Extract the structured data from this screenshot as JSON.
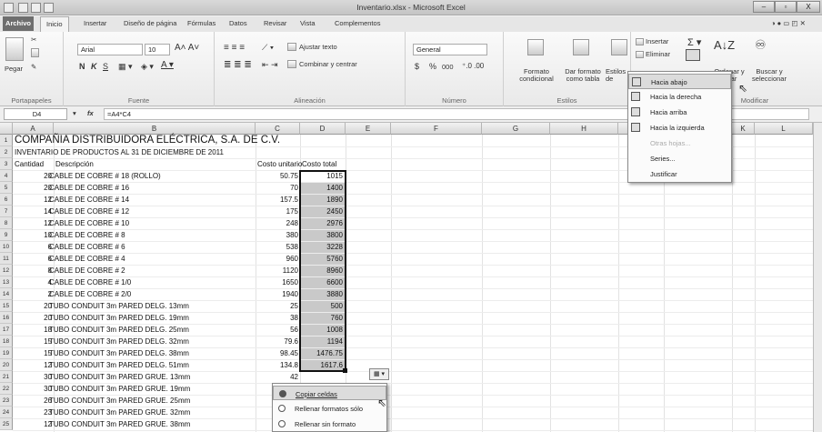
{
  "window": {
    "title": "Inventario.xlsx - Microsoft Excel",
    "minimize": "–",
    "maximize": "▫",
    "close": "X"
  },
  "tabs": [
    "Archivo",
    "Inicio",
    "Insertar",
    "Diseño de página",
    "Fórmulas",
    "Datos",
    "Revisar",
    "Vista",
    "Complementos"
  ],
  "ribbon": {
    "clipboard": {
      "paste": "Pegar",
      "label": "Portapapeles"
    },
    "font": {
      "name": "Arial",
      "size": "10",
      "label": "Fuente",
      "bold": "N",
      "italic": "K",
      "underline": "S"
    },
    "alignment": {
      "wrap": "Ajustar texto",
      "merge": "Combinar y centrar",
      "label": "Alineación"
    },
    "number": {
      "format": "General",
      "currency": "$",
      "percent": "%",
      "thousands": "000",
      "label": "Número"
    },
    "styles": {
      "cond_format": "Formato condicional",
      "as_table": "Dar formato como tabla",
      "cell_styles": "Estilos de celda",
      "label": "Estilos"
    },
    "cells": {
      "insert": "Insertar",
      "delete": "Eliminar"
    },
    "editing": {
      "sort": "Ordenar y filtrar",
      "find": "Buscar y seleccionar",
      "label": "Modificar"
    }
  },
  "formula_bar": {
    "name_box": "D4",
    "fx": "fx",
    "formula": "=A4*C4"
  },
  "columns": [
    "A",
    "B",
    "C",
    "D",
    "E",
    "F",
    "G",
    "H",
    "I",
    "J",
    "K",
    "L"
  ],
  "rows": [
    {
      "n": "1",
      "a": "COMPAÑIA DISTRIBUIDORA ELÉCTRICA, S.A. DE C.V.",
      "title": true
    },
    {
      "n": "2",
      "a": "INVENTARIO DE PRODUCTOS AL 31 DE DICIEMBRE DE 2011"
    },
    {
      "n": "3",
      "a": "Cantidad",
      "b": "Descripción",
      "c": "Costo unitario",
      "d": "Costo total"
    },
    {
      "n": "4",
      "a": "20",
      "b": "CABLE DE COBRE # 18 (ROLLO)",
      "c": "50.75",
      "d": "1015"
    },
    {
      "n": "5",
      "a": "20",
      "b": "CABLE DE COBRE # 16",
      "c": "70",
      "d": "1400"
    },
    {
      "n": "6",
      "a": "12",
      "b": "CABLE DE COBRE # 14",
      "c": "157.5",
      "d": "1890"
    },
    {
      "n": "7",
      "a": "14",
      "b": "CABLE DE COBRE # 12",
      "c": "175",
      "d": "2450"
    },
    {
      "n": "8",
      "a": "12",
      "b": "CABLE DE COBRE # 10",
      "c": "248",
      "d": "2976"
    },
    {
      "n": "9",
      "a": "10",
      "b": "CABLE DE COBRE # 8",
      "c": "380",
      "d": "3800"
    },
    {
      "n": "10",
      "a": "6",
      "b": "CABLE DE COBRE # 6",
      "c": "538",
      "d": "3228"
    },
    {
      "n": "11",
      "a": "6",
      "b": "CABLE DE COBRE # 4",
      "c": "960",
      "d": "5760"
    },
    {
      "n": "12",
      "a": "8",
      "b": "CABLE DE COBRE # 2",
      "c": "1120",
      "d": "8960"
    },
    {
      "n": "13",
      "a": "4",
      "b": "CABLE DE COBRE # 1/0",
      "c": "1650",
      "d": "6600"
    },
    {
      "n": "14",
      "a": "2",
      "b": "CABLE DE COBRE # 2/0",
      "c": "1940",
      "d": "3880"
    },
    {
      "n": "15",
      "a": "20",
      "b": "TUBO CONDUIT 3m PARED DELG. 13mm",
      "c": "25",
      "d": "500"
    },
    {
      "n": "16",
      "a": "20",
      "b": "TUBO CONDUIT 3m PARED DELG. 19mm",
      "c": "38",
      "d": "760"
    },
    {
      "n": "17",
      "a": "18",
      "b": "TUBO CONDUIT 3m PARED DELG. 25mm",
      "c": "56",
      "d": "1008"
    },
    {
      "n": "18",
      "a": "15",
      "b": "TUBO CONDUIT 3m PARED DELG. 32mm",
      "c": "79.6",
      "d": "1194"
    },
    {
      "n": "19",
      "a": "15",
      "b": "TUBO CONDUIT 3m PARED DELG. 38mm",
      "c": "98.45",
      "d": "1476.75"
    },
    {
      "n": "20",
      "a": "12",
      "b": "TUBO CONDUIT 3m PARED DELG. 51mm",
      "c": "134.8",
      "d": "1617.6"
    },
    {
      "n": "21",
      "a": "30",
      "b": "TUBO CONDUIT 3m PARED GRUE. 13mm",
      "c": "42",
      "d": ""
    },
    {
      "n": "22",
      "a": "30",
      "b": "TUBO CONDUIT 3m PARED GRUE. 19mm",
      "c": "",
      "d": ""
    },
    {
      "n": "23",
      "a": "26",
      "b": "TUBO CONDUIT 3m PARED GRUE. 25mm",
      "c": "",
      "d": ""
    },
    {
      "n": "24",
      "a": "23",
      "b": "TUBO CONDUIT 3m PARED GRUE. 32mm",
      "c": "",
      "d": ""
    },
    {
      "n": "25",
      "a": "12",
      "b": "TUBO CONDUIT 3m PARED GRUE. 38mm",
      "c": "",
      "d": ""
    }
  ],
  "fill_menu": {
    "items": [
      {
        "label": "Hacia abajo",
        "state": "hover"
      },
      {
        "label": "Hacia la derecha",
        "state": "normal"
      },
      {
        "label": "Hacia arriba",
        "state": "normal"
      },
      {
        "label": "Hacia la izquierda",
        "state": "normal"
      },
      {
        "label": "Otras hojas...",
        "state": "disabled"
      },
      {
        "label": "Series...",
        "state": "normal"
      },
      {
        "label": "Justificar",
        "state": "normal"
      }
    ]
  },
  "autofill_menu": {
    "items": [
      {
        "label": "Copiar celdas",
        "selected": true
      },
      {
        "label": "Rellenar formatos sólo",
        "selected": false
      },
      {
        "label": "Rellenar sin formato",
        "selected": false
      }
    ]
  },
  "colors": {
    "selection": "#c9c9c9",
    "selection_border": "#111111",
    "menu_highlight": "#dcdcdc"
  }
}
